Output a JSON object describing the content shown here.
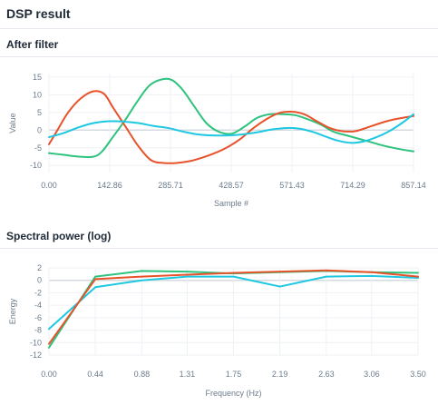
{
  "header": {
    "title": "DSP result"
  },
  "chart_data": [
    {
      "type": "line",
      "title": "After filter",
      "xlabel": "Sample #",
      "ylabel": "Value",
      "xlim": [
        0,
        857.14
      ],
      "ylim": [
        -12,
        16
      ],
      "x_ticks": [
        0,
        142.86,
        285.71,
        428.57,
        571.43,
        714.29,
        857.14
      ],
      "x_tick_labels": [
        "0.00",
        "142.86",
        "285.71",
        "428.57",
        "571.43",
        "714.29",
        "857.14"
      ],
      "y_ticks": [
        15,
        10,
        5,
        0,
        -5,
        -10
      ],
      "y_tick_labels": [
        "15",
        "10",
        "5",
        "0",
        "-5",
        "-10"
      ],
      "grid": true,
      "legend": "none",
      "series": [
        {
          "color": "#2ec27e",
          "points": [
            [
              0,
              -6.5
            ],
            [
              35,
              -7
            ],
            [
              70,
              -7.5
            ],
            [
              105,
              -7.5
            ],
            [
              125,
              -6
            ],
            [
              150,
              -2
            ],
            [
              180,
              3
            ],
            [
              210,
              8.5
            ],
            [
              240,
              13
            ],
            [
              280,
              14.5
            ],
            [
              310,
              12
            ],
            [
              340,
              7
            ],
            [
              370,
              2
            ],
            [
              400,
              -0.5
            ],
            [
              430,
              -1
            ],
            [
              460,
              1
            ],
            [
              490,
              3.5
            ],
            [
              520,
              4.5
            ],
            [
              550,
              4.5
            ],
            [
              580,
              4.2
            ],
            [
              610,
              3
            ],
            [
              640,
              1.5
            ],
            [
              670,
              -0.5
            ],
            [
              700,
              -1.5
            ],
            [
              730,
              -2.5
            ],
            [
              760,
              -3.5
            ],
            [
              790,
              -4.5
            ],
            [
              830,
              -5.5
            ],
            [
              857.14,
              -6
            ]
          ]
        },
        {
          "color": "#e8522b",
          "points": [
            [
              0,
              -4
            ],
            [
              20,
              0
            ],
            [
              45,
              5
            ],
            [
              75,
              9
            ],
            [
              105,
              11
            ],
            [
              130,
              10.2
            ],
            [
              150,
              6.5
            ],
            [
              180,
              1
            ],
            [
              210,
              -4.5
            ],
            [
              240,
              -8.5
            ],
            [
              270,
              -9.3
            ],
            [
              300,
              -9.3
            ],
            [
              330,
              -8.8
            ],
            [
              360,
              -7.8
            ],
            [
              390,
              -6.5
            ],
            [
              420,
              -4.8
            ],
            [
              450,
              -2.5
            ],
            [
              480,
              0.5
            ],
            [
              510,
              3
            ],
            [
              540,
              4.8
            ],
            [
              570,
              5.2
            ],
            [
              600,
              4.5
            ],
            [
              630,
              2.5
            ],
            [
              660,
              0.6
            ],
            [
              690,
              -0.3
            ],
            [
              720,
              -0.3
            ],
            [
              750,
              0.8
            ],
            [
              780,
              2
            ],
            [
              810,
              3
            ],
            [
              857.14,
              4
            ]
          ]
        },
        {
          "color": "#1ec8e0",
          "points": [
            [
              0,
              -2
            ],
            [
              35,
              -0.8
            ],
            [
              70,
              0.8
            ],
            [
              105,
              2
            ],
            [
              140,
              2.5
            ],
            [
              175,
              2.4
            ],
            [
              210,
              2
            ],
            [
              245,
              1.2
            ],
            [
              280,
              0.6
            ],
            [
              315,
              -0.4
            ],
            [
              350,
              -1.2
            ],
            [
              385,
              -1.5
            ],
            [
              420,
              -1.5
            ],
            [
              455,
              -1.2
            ],
            [
              490,
              -0.6
            ],
            [
              525,
              0.2
            ],
            [
              560,
              0.6
            ],
            [
              590,
              0.4
            ],
            [
              620,
              -0.5
            ],
            [
              650,
              -1.8
            ],
            [
              680,
              -3
            ],
            [
              710,
              -3.6
            ],
            [
              740,
              -3.2
            ],
            [
              770,
              -2
            ],
            [
              800,
              -0.3
            ],
            [
              830,
              2
            ],
            [
              857.14,
              4.5
            ]
          ]
        }
      ]
    },
    {
      "type": "line",
      "title": "Spectral power (log)",
      "xlabel": "Frequency (Hz)",
      "ylabel": "Energy",
      "xlim": [
        0,
        3.5
      ],
      "ylim": [
        -12,
        2
      ],
      "x_ticks": [
        0,
        0.44,
        0.88,
        1.31,
        1.75,
        2.19,
        2.63,
        3.06,
        3.5
      ],
      "x_tick_labels": [
        "0.00",
        "0.44",
        "0.88",
        "1.31",
        "1.75",
        "2.19",
        "2.63",
        "3.06",
        "3.50"
      ],
      "y_ticks": [
        2,
        0,
        -2,
        -4,
        -6,
        -8,
        -10,
        -12
      ],
      "y_tick_labels": [
        "2",
        "0",
        "-2",
        "-4",
        "-6",
        "-8",
        "-10",
        "-12"
      ],
      "grid": true,
      "legend": "none",
      "series": [
        {
          "color": "#2ec27e",
          "points": [
            [
              0,
              -10.8
            ],
            [
              0.44,
              0.6
            ],
            [
              0.88,
              1.5
            ],
            [
              1.31,
              1.4
            ],
            [
              1.75,
              1.1
            ],
            [
              2.19,
              1.3
            ],
            [
              2.63,
              1.5
            ],
            [
              3.06,
              1.3
            ],
            [
              3.5,
              1.2
            ]
          ]
        },
        {
          "color": "#1ec8e0",
          "points": [
            [
              0,
              -7.8
            ],
            [
              0.44,
              -1.1
            ],
            [
              0.88,
              0.0
            ],
            [
              1.31,
              0.6
            ],
            [
              1.75,
              0.6
            ],
            [
              2.19,
              -1.0
            ],
            [
              2.63,
              0.6
            ],
            [
              3.06,
              0.7
            ],
            [
              3.5,
              0.4
            ]
          ]
        },
        {
          "color": "#e8522b",
          "points": [
            [
              0,
              -10.2
            ],
            [
              0.44,
              0.2
            ],
            [
              0.88,
              0.6
            ],
            [
              1.31,
              0.9
            ],
            [
              1.75,
              1.2
            ],
            [
              2.19,
              1.4
            ],
            [
              2.63,
              1.6
            ],
            [
              3.06,
              1.3
            ],
            [
              3.5,
              0.6
            ]
          ]
        }
      ]
    }
  ]
}
